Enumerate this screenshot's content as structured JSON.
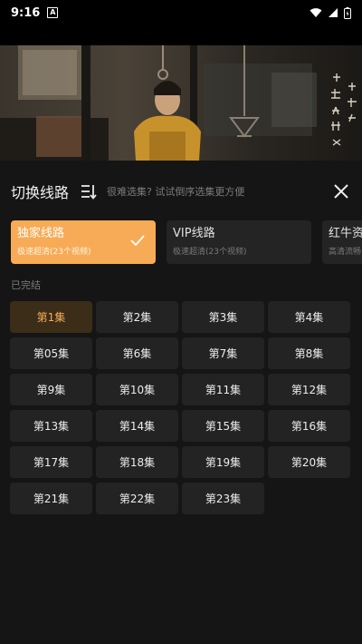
{
  "status_bar": {
    "time": "9:16",
    "notif": "A"
  },
  "panel": {
    "title": "切换线路",
    "hint": "很难选集? 试试倒序选集更方便"
  },
  "routes": [
    {
      "name": "独家线路",
      "sub": "极速超清(23个视频)",
      "active": true
    },
    {
      "name": "VIP线路",
      "sub": "极速超清(23个视频)",
      "active": false
    },
    {
      "name": "红牛资源",
      "sub": "高清流畅",
      "active": false
    }
  ],
  "status_label": "已完结",
  "episodes": [
    "第1集",
    "第2集",
    "第3集",
    "第4集",
    "第05集",
    "第6集",
    "第7集",
    "第8集",
    "第9集",
    "第10集",
    "第11集",
    "第12集",
    "第13集",
    "第14集",
    "第15集",
    "第16集",
    "第17集",
    "第18集",
    "第19集",
    "第20集",
    "第21集",
    "第22集",
    "第23集"
  ],
  "selected_episode": "第1集",
  "colors": {
    "accent": "#f7ab56",
    "background": "#151515",
    "tile": "#232323"
  }
}
